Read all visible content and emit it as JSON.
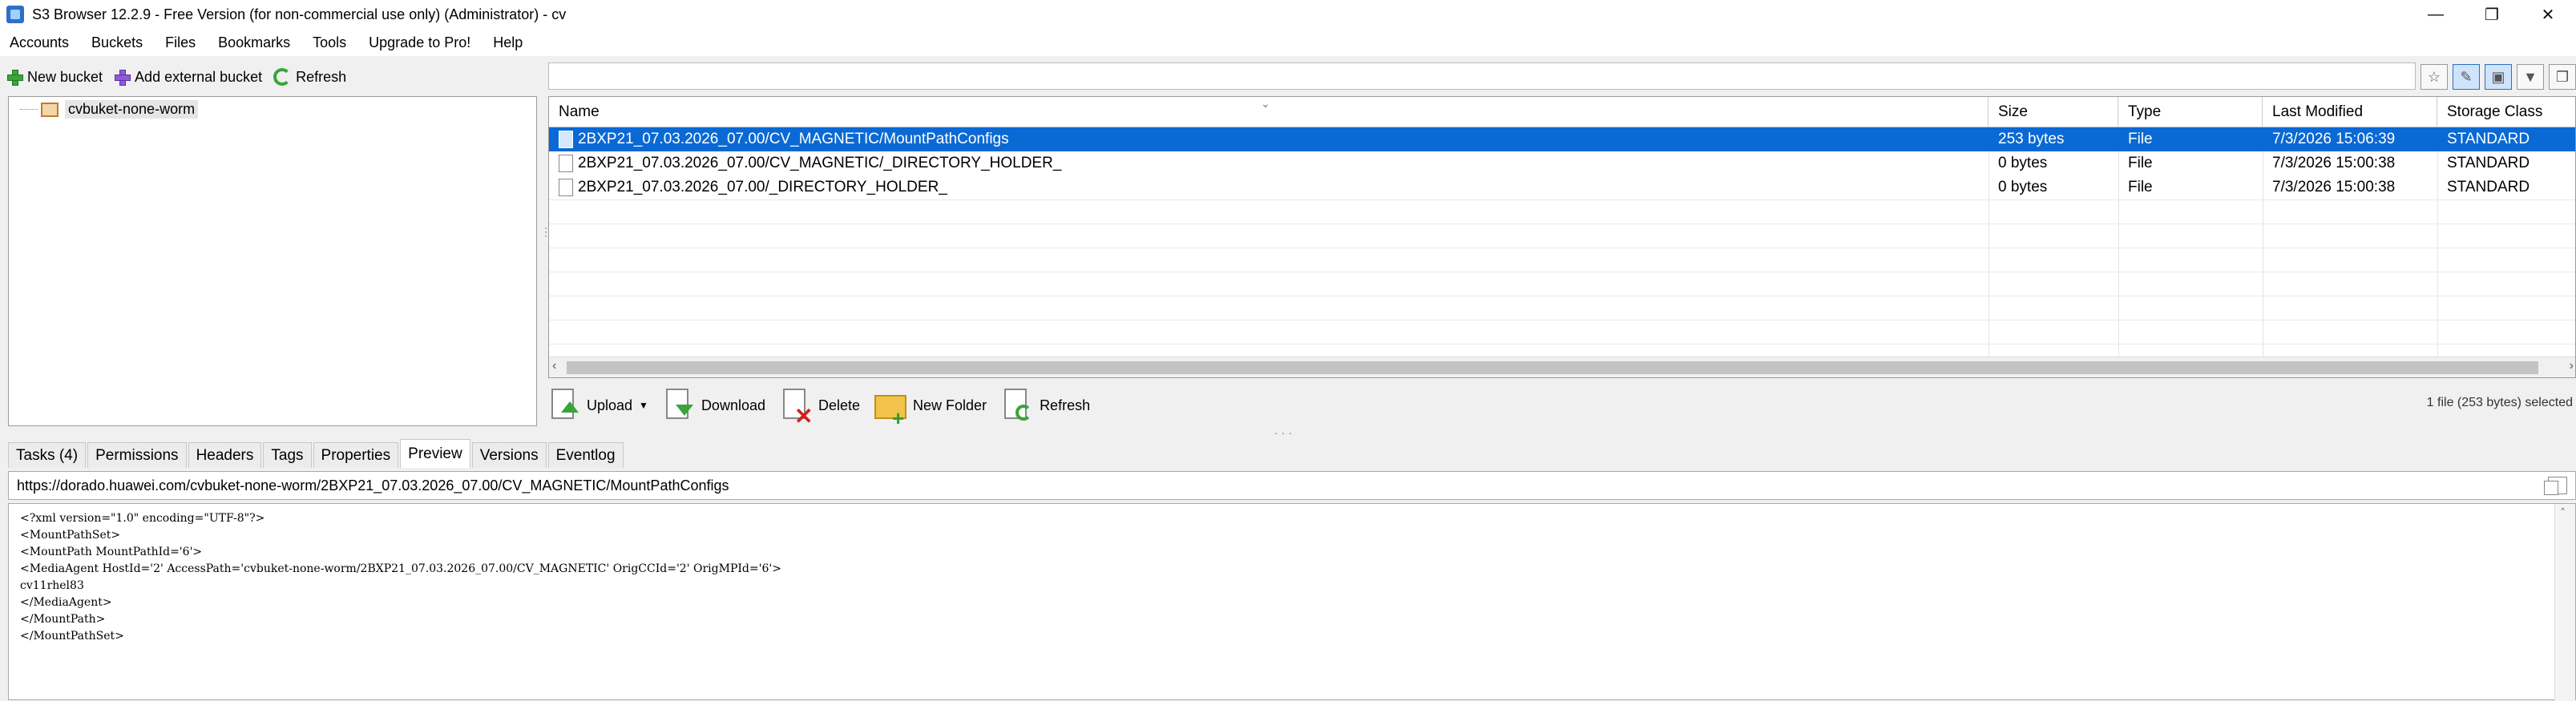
{
  "window": {
    "title": "S3 Browser 12.2.9 - Free Version (for non-commercial use only) (Administrator) - cv",
    "controls": [
      "—",
      "❐",
      "✕"
    ]
  },
  "menu": [
    "Accounts",
    "Buckets",
    "Files",
    "Bookmarks",
    "Tools",
    "Upgrade to Pro!",
    "Help"
  ],
  "left_toolbar": {
    "new_bucket": "New bucket",
    "add_external_bucket": "Add external bucket",
    "refresh": "Refresh"
  },
  "tree": {
    "buckets": [
      "cvbuket-none-worm"
    ]
  },
  "filter": {
    "value": "",
    "icons": [
      "star-icon",
      "pencil-icon",
      "view-icon",
      "filter-icon",
      "columns-icon"
    ]
  },
  "file_list": {
    "columns": [
      "Name",
      "Size",
      "Type",
      "Last Modified",
      "Storage Class"
    ],
    "rows": [
      {
        "name": "2BXP21_07.03.2026_07.00/CV_MAGNETIC/MountPathConfigs",
        "size": "253 bytes",
        "type": "File",
        "modified": "7/3/2026 15:06:39",
        "storage": "STANDARD",
        "selected": true
      },
      {
        "name": "2BXP21_07.03.2026_07.00/CV_MAGNETIC/_DIRECTORY_HOLDER_",
        "size": "0 bytes",
        "type": "File",
        "modified": "7/3/2026 15:00:38",
        "storage": "STANDARD",
        "selected": false
      },
      {
        "name": "2BXP21_07.03.2026_07.00/_DIRECTORY_HOLDER_",
        "size": "0 bytes",
        "type": "File",
        "modified": "7/3/2026 15:00:38",
        "storage": "STANDARD",
        "selected": false
      }
    ]
  },
  "actions": {
    "upload": "Upload",
    "download": "Download",
    "delete": "Delete",
    "new_folder": "New Folder",
    "refresh": "Refresh",
    "status": "1 file (253 bytes) selected"
  },
  "tabs": [
    {
      "label": "Tasks (4)",
      "active": false
    },
    {
      "label": "Permissions",
      "active": false
    },
    {
      "label": "Headers",
      "active": false
    },
    {
      "label": "Tags",
      "active": false
    },
    {
      "label": "Properties",
      "active": false
    },
    {
      "label": "Preview",
      "active": true
    },
    {
      "label": "Versions",
      "active": false
    },
    {
      "label": "Eventlog",
      "active": false
    }
  ],
  "preview": {
    "url": "https://dorado.huawei.com/cvbuket-none-worm/2BXP21_07.03.2026_07.00/CV_MAGNETIC/MountPathConfigs",
    "content": "<?xml version=\"1.0\" encoding=\"UTF-8\"?>\n<MountPathSet>\n<MountPath MountPathId='6'>\n<MediaAgent HostId='2' AccessPath='cvbuket-none-worm/2BXP21_07.03.2026_07.00/CV_MAGNETIC' OrigCCId='2' OrigMPId='6'>\ncv11rhel83\n</MediaAgent>\n</MountPath>\n</MountPathSet>"
  }
}
